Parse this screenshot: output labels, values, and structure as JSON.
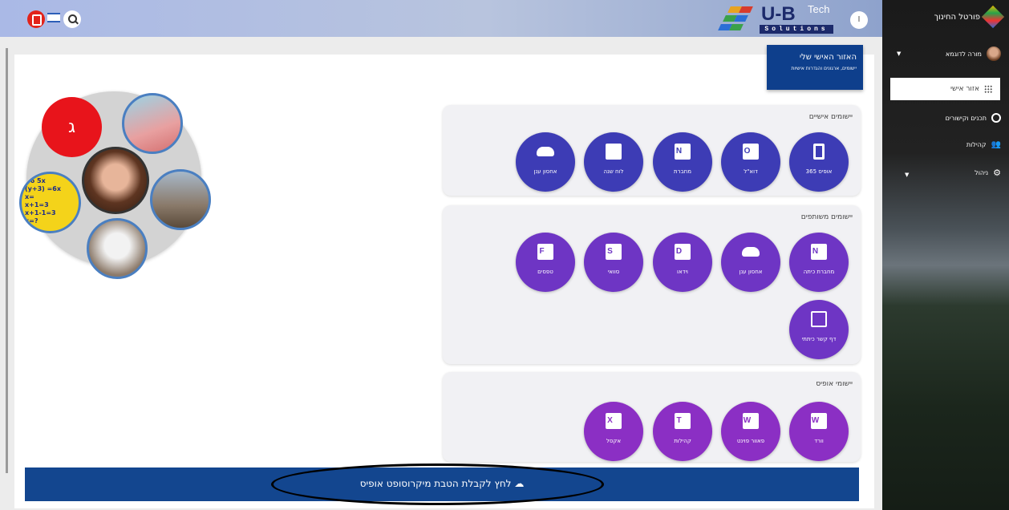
{
  "header": {
    "logo_main": "U-B",
    "logo_tech": "Tech",
    "logo_sub": "Solutions",
    "user_initial": "I"
  },
  "sidebar": {
    "portal_title": "פורטל החינוך",
    "user_name": "מורה לדוגמא",
    "items": [
      {
        "label": "אזור אישי",
        "icon": "grid-icon"
      },
      {
        "label": "תכנים וקישורים",
        "icon": "globe-icon"
      },
      {
        "label": "קהילות",
        "icon": "people-icon"
      },
      {
        "label": "ניהול",
        "icon": "gear-icon"
      }
    ]
  },
  "personal_area": {
    "title": "האזור האישי שלי",
    "subtitle": "יישומים, ארגונים והגדרות אישיות"
  },
  "panels": {
    "personal_apps": {
      "title": "יישומים אישיים",
      "apps": [
        {
          "label": "אופיס 365",
          "icon": "office-icon"
        },
        {
          "label": "דוא\"ל",
          "icon": "outlook-icon"
        },
        {
          "label": "מחברת",
          "icon": "onenote-icon"
        },
        {
          "label": "לוח שנה",
          "icon": "calendar-icon"
        },
        {
          "label": "אחסון ענן",
          "icon": "onedrive-icon"
        }
      ]
    },
    "shared_apps": {
      "title": "יישומים משותפים",
      "apps": [
        {
          "label": "מחברת כיתה",
          "icon": "onenote-class-icon"
        },
        {
          "label": "אחסון ענן",
          "icon": "onedrive-icon"
        },
        {
          "label": "וידאו",
          "icon": "stream-icon"
        },
        {
          "label": "סוואי",
          "icon": "sway-icon"
        },
        {
          "label": "טפסים",
          "icon": "forms-icon"
        },
        {
          "label": "דף קשר כיתתי",
          "icon": "contact-book-icon"
        }
      ]
    },
    "office_apps": {
      "title": "יישומי אופיס",
      "apps": [
        {
          "label": "וורד",
          "icon": "word-icon"
        },
        {
          "label": "פאוור פוינט",
          "icon": "word-icon"
        },
        {
          "label": "קהילות",
          "icon": "teams-icon"
        },
        {
          "label": "אקסל",
          "icon": "excel-icon"
        }
      ]
    }
  },
  "cluster": {
    "red_letter": "ג",
    "math_text": "+6 5x\n(y+3) =6x\nx=\nx+1=3\nx+1-1=3\nx=?"
  },
  "banner": {
    "text": "לחץ לקבלת הטבת מיקרוסופט אופיס"
  },
  "colors": {
    "app_dark": "#3d3cb5",
    "app_mid": "#6e35c4",
    "app_purple": "#8b2fc4",
    "banner": "#13468f",
    "personal_box": "#0e3f8c"
  }
}
